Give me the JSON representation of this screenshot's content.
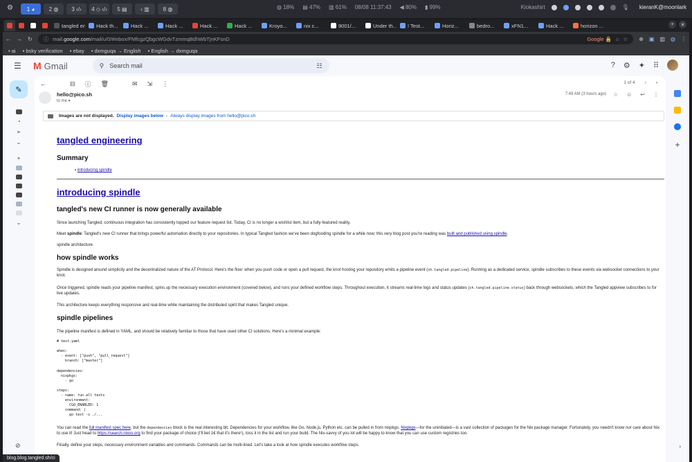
{
  "topbar": {
    "workspaces": [
      "1 ◕",
      "2 ◍",
      "3 ‹/›",
      "4 ◇ ‹/›",
      "5 ▤",
      "‹ ▥",
      "8 ◍"
    ],
    "stats": [
      "◍ 18%",
      "▤ 47%",
      "▥ 61%",
      "08/08 11:37:43",
      "◀ 80%",
      "▮ 99%"
    ],
    "kb": "Kiokashirt",
    "user": "kieranK@moonlark"
  },
  "tabs": [
    {
      "label": "",
      "color": "#ea4335",
      "current": true
    },
    {
      "label": "",
      "color": "#ea4335"
    },
    {
      "label": "",
      "color": "#ffffff"
    },
    {
      "label": "",
      "color": "#ea4335"
    },
    {
      "label": "tangled eng...",
      "color": "#555"
    },
    {
      "label": "Hack th...",
      "color": "#6ea0ff"
    },
    {
      "label": "Hack ...",
      "color": "#6ea0ff"
    },
    {
      "label": "Hack ...",
      "color": "#6ea0ff"
    },
    {
      "label": "Hack ...",
      "color": "#ea4335"
    },
    {
      "label": "Hack ...",
      "color": "#2bb24c"
    },
    {
      "label": "Kroyo...",
      "color": "#6ea0ff"
    },
    {
      "label": "nix c...",
      "color": "#6ea0ff"
    },
    {
      "label": "9001/...",
      "color": "#ffffff"
    },
    {
      "label": "Under th...",
      "color": "#ffffff"
    },
    {
      "label": "! Test...",
      "color": "#6ea0ff"
    },
    {
      "label": "Horiz...",
      "color": "#6ea0ff"
    },
    {
      "label": "bedro...",
      "color": "#888"
    },
    {
      "label": "xFN1...",
      "color": "#6ea0ff"
    },
    {
      "label": "Hack ...",
      "color": "#6ea0ff"
    },
    {
      "label": "horizon ...",
      "color": "#ff7043"
    }
  ],
  "omnibox": {
    "host_prefix": "mail.",
    "host": "google.com",
    "path": "/mail/u/0/#inbox/FMfcgzQbgcWGdvTzmmqBdhWbTjnKFsnD",
    "account": "Google 🔒"
  },
  "bookmarks": [
    "ai",
    "bsky verification",
    "ebay",
    "dxmguqa → English",
    "English → dxmguqa"
  ],
  "gmail": {
    "brand": "Gmail",
    "search_placeholder": "Search mail",
    "pager": "1 of 4",
    "sender": "hello@pico.sh",
    "to": "to me",
    "time": "7:49 AM (3 hours ago)",
    "images_notice": "Images are not displayed.",
    "display_images": "Display images below",
    "always_display": "Always display images from hello@pico.sh"
  },
  "email": {
    "title": "tangled engineering",
    "summary": "Summary",
    "toc_link": "introducing spindle",
    "h_intro": "introducing spindle",
    "h_ga": "tangled's new CI runner is now generally available",
    "p1": "Since launching Tangled, continuous integration has consistently topped our feature request list. Today, CI is no longer a wishlist item, but a fully-featured reality.",
    "p2_a": "Meet ",
    "p2_b": "spindle",
    "p2_c": ": Tangled's new CI runner that brings powerful automation directly to your repositories. In typical Tangled fashion we've been dogfooding spindle for a while now; this very blog post you're reading was ",
    "p2_link": "built and published using spindle",
    "p2_d": ".",
    "arch_label": "spindle architecture",
    "h_how": "how spindle works",
    "p3_a": "Spindle is designed around simplicity and the decentralized nature of the AT Protocol. Here's the flow: when you push code or open a pull request, the knot hosting your repository emits a pipeline event (",
    "p3_code": "sh.tangled.pipeline",
    "p3_b": "). Running as a dedicated service, spindle subscribes to these events via websocket connections to your knot.",
    "p4_a": "Once triggered, spindle reads your pipeline manifest, spins up the necessary execution environment (covered below), and runs your defined workflow steps. Throughout execution, it streams real-time logs and status updates (",
    "p4_code": "sh.tangled.pipeline.status",
    "p4_b": ") back through websockets, which the Tangled appview subscribes to for live updates.",
    "p5": "This architecture keeps everything responsive and real-time while maintaining the distributed spirit that makes Tangled unique.",
    "h_pipe": "spindle pipelines",
    "p6": "The pipeline manifest is defined in YAML, and should be relatively familiar to those that have used other CI solutions. Here's a minimal example:",
    "code": "# test.yaml\n\nwhen:\n  - event: [\"push\", \"pull_request\"]\n    branch: [\"master\"]\n\ndependencies:\n  nixpkgs:\n    - go\n\nsteps:\n  - name: run all tests\n    environment:\n      CGO_ENABLED: 1\n    command: |\n      go test -v ./...",
    "p7_a": "You can read the ",
    "p7_link1": "full manifest spec here",
    "p7_b": ", but the ",
    "p7_code": "dependencies",
    "p7_c": " block is the real interesting bit. Dependencies for your workflow, like Go, Node.js, Python etc. can be pulled in from nixpkgs. ",
    "p7_link2": "Nixpkgs",
    "p7_d": "—for the uninitiated—is a vast collection of packages for the Nix package manager. Fortunately, you needn't know nor care about Nix to use it! Just head to ",
    "p7_link3": "https://search.nixos.org",
    "p7_e": " to find your package of choice (I'll bet 1€ that it's there¹), toss it in the list and run your build. The Nix-savvy of you lot will be happy to know that you can use custom registries too.",
    "p8": "Finally, define your steps, necessary environment variables and commands. Commands can be multi-lined. Let's take a look at how spindle executes workflow steps."
  },
  "statusbar": "blog.blog.tangled.sh/ci"
}
